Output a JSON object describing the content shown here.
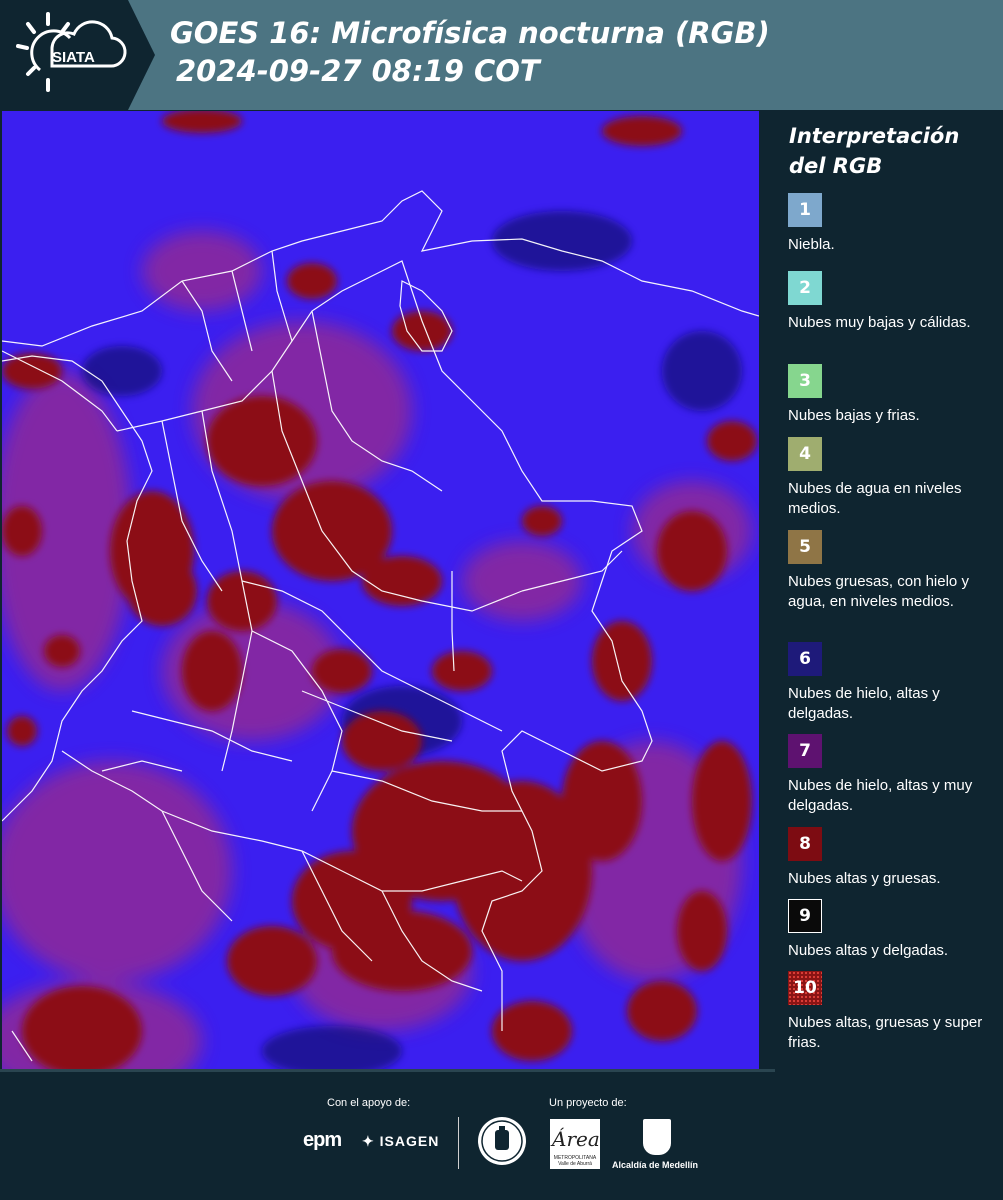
{
  "header": {
    "logo_text": "SIATA",
    "title_line1": "GOES 16: Microfísica nocturna (RGB)",
    "title_line2": "2024-09-27 08:19 COT",
    "background_color": "#4c7482"
  },
  "map": {
    "base_color": "#3b1ff0",
    "thick_cloud_color": "#8c0a12",
    "thin_cloud_color": "#9a2a8c",
    "border_color": "#ffffff"
  },
  "legend": {
    "title_line1": "Interpretación",
    "title_line2": "del RGB",
    "items": [
      {
        "number": "1",
        "label": "Niebla.",
        "color": "#7ea8cc"
      },
      {
        "number": "2",
        "label": "Nubes muy bajas y cálidas.",
        "color": "#7fd8d2"
      },
      {
        "number": "3",
        "label": "Nubes bajas y frias.",
        "color": "#86d68e"
      },
      {
        "number": "4",
        "label": "Nubes de agua en niveles medios.",
        "color": "#9fad6f"
      },
      {
        "number": "5",
        "label": "Nubes gruesas, con hielo y agua, en niveles medios.",
        "color": "#8f7546"
      },
      {
        "number": "6",
        "label": "Nubes de hielo, altas y delgadas.",
        "color": "#1e1a7a"
      },
      {
        "number": "7",
        "label": "Nubes de hielo, altas y muy delgadas.",
        "color": "#5e1270"
      },
      {
        "number": "8",
        "label": "Nubes altas y gruesas.",
        "color": "#7d0c12"
      },
      {
        "number": "9",
        "label": "Nubes altas y delgadas.",
        "color": "#0a0a0a"
      },
      {
        "number": "10",
        "label": "Nubes altas, gruesas y super frias.",
        "color": "#8a1414"
      }
    ]
  },
  "footer": {
    "support_label": "Con el apoyo de:",
    "project_label": "Un proyecto de:",
    "sponsor1": "epm",
    "sponsor2": "ISAGEN",
    "partner1_title": "Área",
    "partner1_subtitle": "METROPOLITANA Valle de Aburrá",
    "partner2": "Alcaldía de Medellín"
  }
}
